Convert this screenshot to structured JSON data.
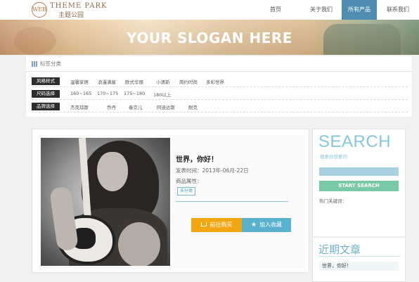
{
  "logo": {
    "mark": "WEB",
    "top_text": "THEME PARK",
    "bottom_text": "主题公园"
  },
  "nav": {
    "items": [
      {
        "label": "首页"
      },
      {
        "label": "关于我们"
      },
      {
        "label": "所有产品",
        "active": true
      },
      {
        "label": "联系我们"
      }
    ]
  },
  "banner": {
    "slogan": "YOUR SLOGAN HERE"
  },
  "filters": {
    "title": "标签分类",
    "rows": [
      {
        "label": "风格样式",
        "options": [
          "温馨家居",
          "浪漫满屋",
          "欧式华丽",
          "小清新",
          "简约时尚",
          "多彩世界"
        ]
      },
      {
        "label": "尺码选择",
        "options": [
          "160~165",
          "170~175",
          "175~180",
          "180以上"
        ]
      },
      {
        "label": "品牌选择",
        "options": [
          "杰克琼斯",
          "乔丹",
          "春京儿",
          "阿迪达斯",
          "耐克"
        ]
      }
    ]
  },
  "product": {
    "title": "世界，你好！",
    "date": "发表时间：2013年-06月-22日",
    "attr": "商品属性：",
    "tag": "未分类",
    "buy_label": "前往购买",
    "fav_label": "加入收藏"
  },
  "sidebar": {
    "search_title": "SEARCH",
    "search_sub": "搜索你想要的",
    "search_value": "",
    "search_button": "START SEARCH",
    "hot_label": "热门关键词：",
    "recent_title": "近期文章",
    "recent_items": [
      "世界，你好！"
    ]
  },
  "colors": {
    "accent": "#4f8db3",
    "buy": "#f2a712",
    "fav": "#5ab1cd",
    "search_btn": "#78caa4"
  }
}
